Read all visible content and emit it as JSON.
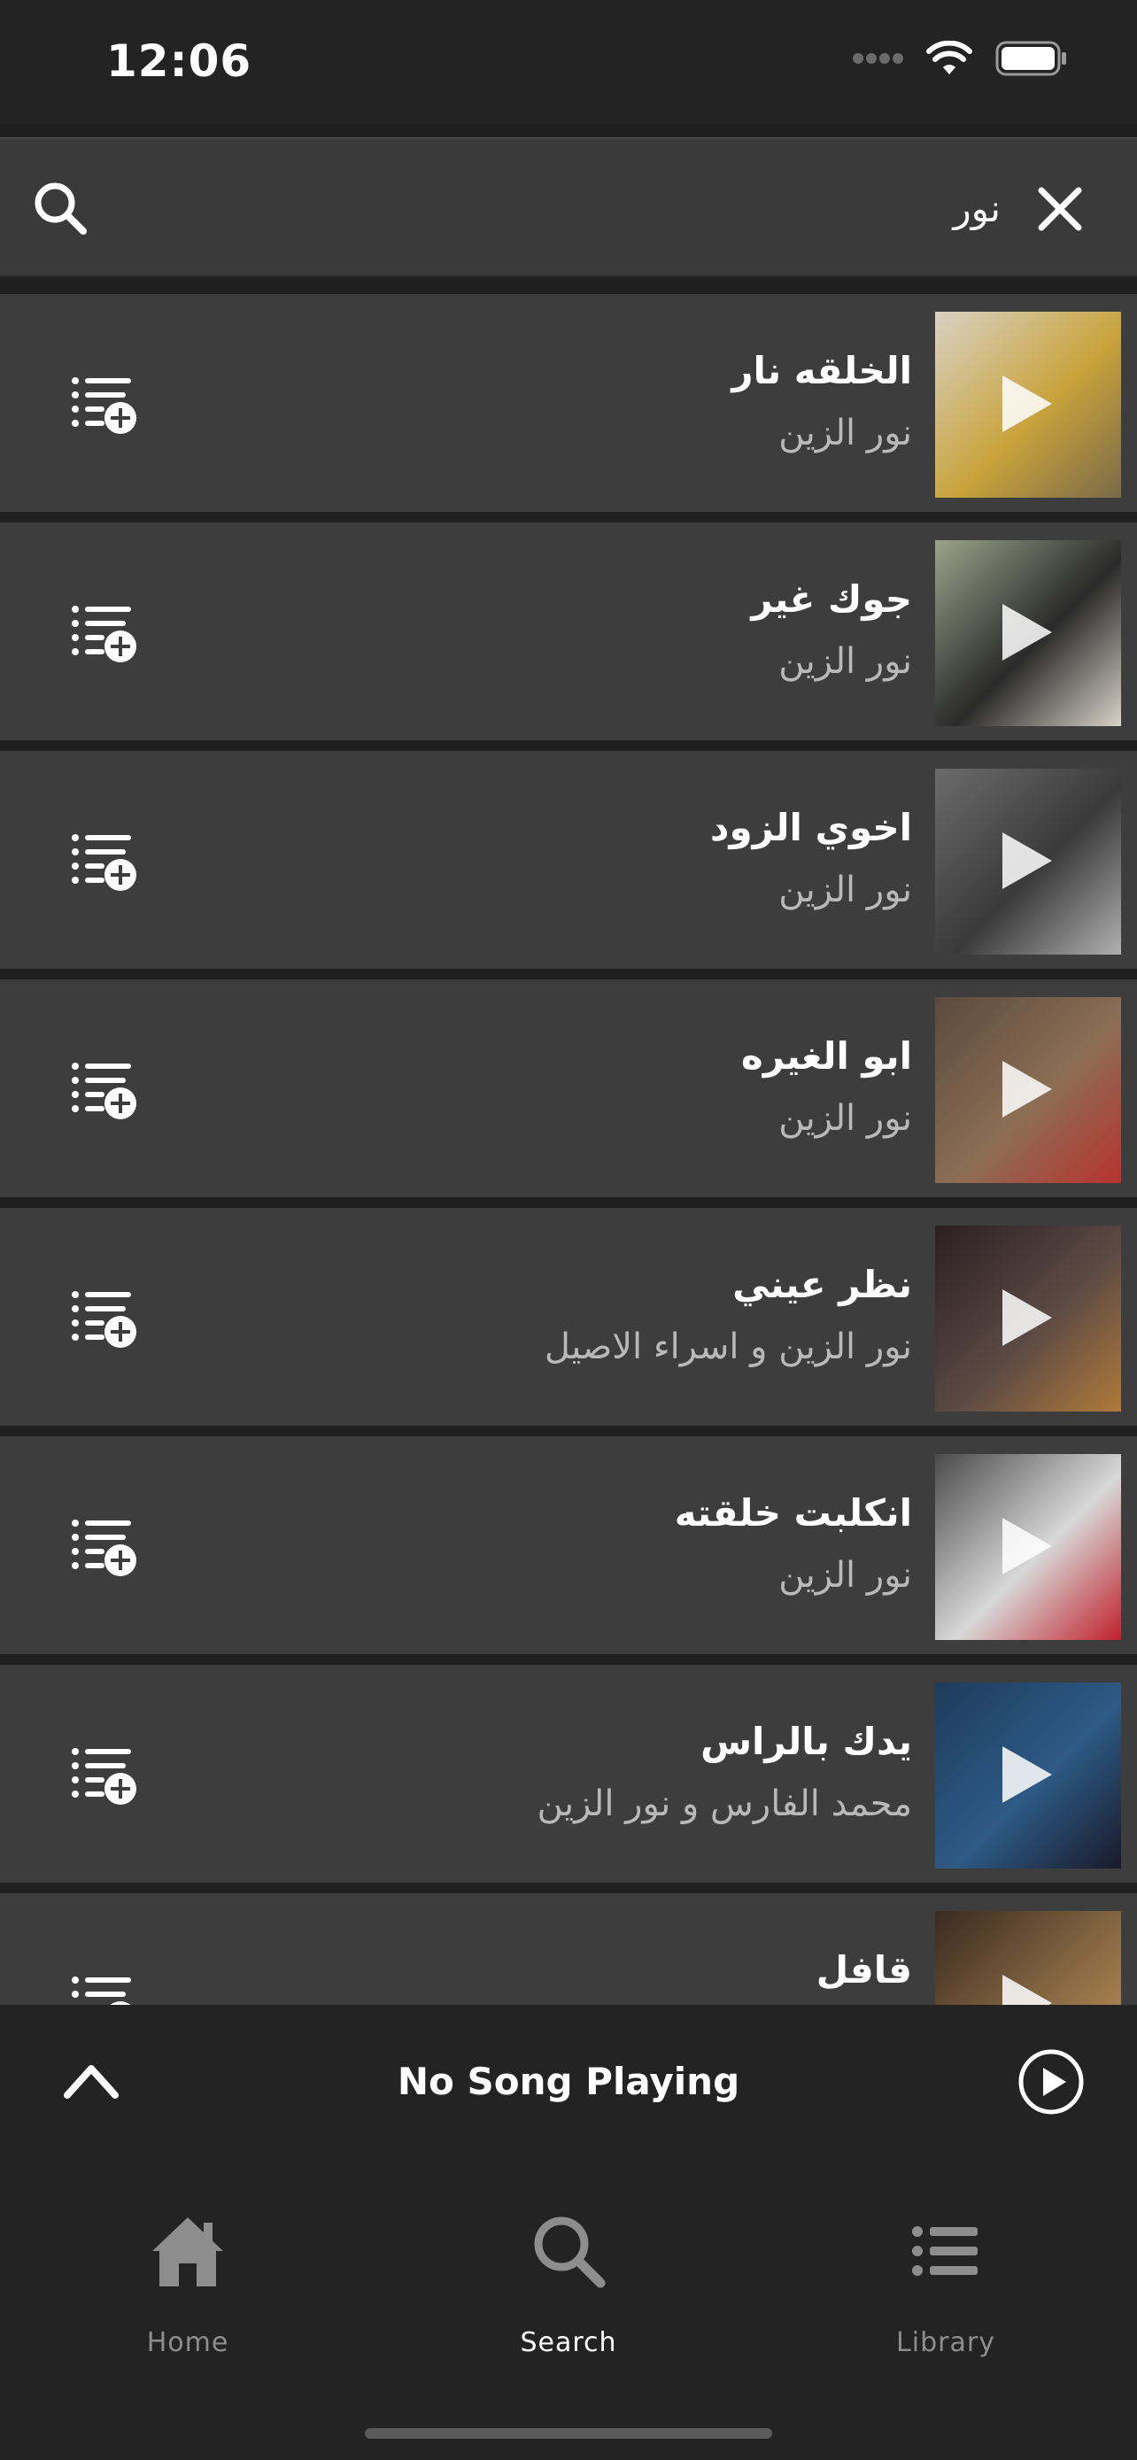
{
  "status_bar": {
    "time": "12:06"
  },
  "search": {
    "query": "نور"
  },
  "results": [
    {
      "title": "الخلقه نار",
      "artist": "نور الزين",
      "thumb_colors": [
        "#d9d2c4",
        "#c9a33b",
        "#7a6a48"
      ]
    },
    {
      "title": "جوك غير",
      "artist": "نور الزين",
      "thumb_colors": [
        "#9aa38a",
        "#2a2a2a",
        "#d8d2c8"
      ]
    },
    {
      "title": "اخوي الزود",
      "artist": "نور الزين",
      "thumb_colors": [
        "#6b6b6b",
        "#3a3a3a",
        "#b0b0b0"
      ]
    },
    {
      "title": "ابو الغيره",
      "artist": "نور الزين",
      "thumb_colors": [
        "#5a4a3e",
        "#8c6e54",
        "#b8332f"
      ]
    },
    {
      "title": "نظر عيني",
      "artist": "نور الزين و اسراء الاصيل",
      "thumb_colors": [
        "#2a1f22",
        "#5c4a44",
        "#b07a3a"
      ]
    },
    {
      "title": "انكلبت خلقته",
      "artist": "نور الزين",
      "thumb_colors": [
        "#4a4a4a",
        "#d8d8d8",
        "#c0202a"
      ]
    },
    {
      "title": "يدك بالراس",
      "artist": "محمد الفارس و نور الزين",
      "thumb_colors": [
        "#1e3b5c",
        "#2d5a85",
        "#1a1a2a"
      ]
    },
    {
      "title": "قافل",
      "artist": "",
      "thumb_colors": [
        "#3a2a20",
        "#8a6a44",
        "#c79a5a"
      ]
    }
  ],
  "mini_player": {
    "label": "No Song Playing"
  },
  "tabs": [
    {
      "label": "Home",
      "icon": "home-icon",
      "active": false
    },
    {
      "label": "Search",
      "icon": "search-icon",
      "active": true
    },
    {
      "label": "Library",
      "icon": "library-icon",
      "active": false
    }
  ],
  "colors": {
    "background": "#1f1f1f",
    "row": "#3d3d3d",
    "muted_text": "#b9b9b9",
    "inactive_tab": "#8d8d8d"
  }
}
